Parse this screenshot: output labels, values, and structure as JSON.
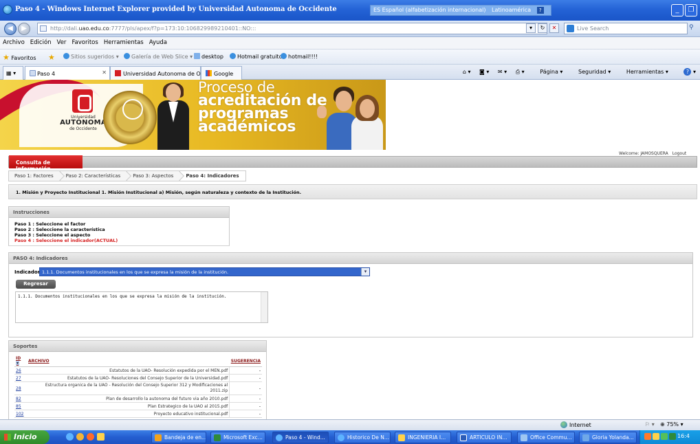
{
  "window": {
    "title": "Paso 4 - Windows Internet Explorer provided by Universidad Autonoma de Occidente",
    "lang_indicator": "ES Español (alfabetización internacional)",
    "keyboard_layout": "Latinoamérica"
  },
  "address": {
    "url_prefix": "http://dali.",
    "url_host": "uao.edu.co",
    "url_rest": ":7777/pls/apex/f?p=173:10:106829989210401::NO:::",
    "search_placeholder": "Live Search"
  },
  "menu": [
    "Archivo",
    "Edición",
    "Ver",
    "Favoritos",
    "Herramientas",
    "Ayuda"
  ],
  "favorites": {
    "label": "Favoritos",
    "items": [
      "Sitios sugeridos",
      "Galería de Web Slice",
      "desktop",
      "Hotmail gratuito",
      "hotmail!!!!"
    ]
  },
  "tabs": [
    "Paso 4",
    "Universidad Autonoma de Oc...",
    "Google"
  ],
  "command_bar": [
    "Página",
    "Seguridad",
    "Herramientas"
  ],
  "banner": {
    "title_lines": [
      "Proceso de",
      "acreditación de",
      "programas",
      "académicos"
    ],
    "logo_small_top": "Universidad",
    "logo_big": "AUTÓNOMA",
    "logo_small_bottom": "de Occidente"
  },
  "user": {
    "welcome": "Welcome: JAMOSQUERA",
    "logout": "Logout"
  },
  "nav": {
    "tab": "Consulta de Información"
  },
  "breadcrumb": [
    "Paso 1: Factores",
    "Paso 2: Características",
    "Paso 3: Aspectos",
    "Paso 4: Indicadores"
  ],
  "path": "1. Misión y Proyecto Institucional  1. Misión Institucional  a) Misión, según naturaleza y contexto de la Institución.",
  "instructions": {
    "title": "Instrucciones",
    "lines": [
      "Paso 1 : Seleccione el factor",
      "Paso 2 : Seleccione la característica",
      "Paso 3 : Seleccione el aspecto",
      "Paso 4 : Seleccione el indicador(ACTUAL)"
    ]
  },
  "paso4": {
    "title": "PASO 4: Indicadores",
    "label": "Indicador",
    "selected": "1.1.1. Documentos institucionales en los que se expresa la misión de la institución.",
    "button": "Regresar",
    "text": "1.1.1. Documentos institucionales en los que se expresa la misión de la institución."
  },
  "soportes": {
    "title": "Soportes",
    "headers": {
      "id": "ID",
      "archivo": "ARCHIVO",
      "sugerencia": "SUGERENCIA"
    },
    "rows": [
      {
        "id": "26",
        "archivo": "Estatutos de la UAO- Resolución expedida por el MEN.pdf",
        "sug": "-"
      },
      {
        "id": "27",
        "archivo": "Estatutos de la UAO- Resoluciones del Consejo Superior de la Universidad.pdf",
        "sug": "-"
      },
      {
        "id": "28",
        "archivo": "Estructura organica de la UAO - Resolución del Consejo Superior 312 y Modificaciones al 2011.zip",
        "sug": "-"
      },
      {
        "id": "82",
        "archivo": "Plan de desarrollo la autonoma del futuro via año 2010.pdf",
        "sug": "-"
      },
      {
        "id": "85",
        "archivo": "Plan Estrategico de la UAO al 2015.pdf",
        "sug": "-"
      },
      {
        "id": "102",
        "archivo": "Proyecto educativo institucional.pdf",
        "sug": "-"
      }
    ]
  },
  "status": {
    "zone": "Internet",
    "zoom": "75%"
  },
  "taskbar": {
    "start": "Inicio",
    "buttons": [
      "Bandeja de en...",
      "Microsoft Exc...",
      "Paso 4 - Wind...",
      "Historico De N...",
      "INGENIERIA I...",
      "ARTICULO IN...",
      "Office Commu...",
      "Gloria Yolanda..."
    ],
    "clock": "16:4"
  },
  "colors": {
    "nav_red": "#c8102e",
    "select_blue": "#3366cc",
    "instr_current": "#d51c1c",
    "taskbar": "#245ed0"
  }
}
